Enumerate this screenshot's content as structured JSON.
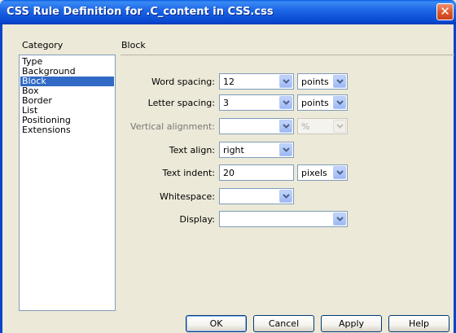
{
  "window": {
    "title": "CSS Rule Definition for .C_content in CSS.css"
  },
  "category": {
    "header": "Category",
    "items": [
      "Type",
      "Background",
      "Block",
      "Box",
      "Border",
      "List",
      "Positioning",
      "Extensions"
    ],
    "selected": "Block"
  },
  "panel": {
    "title": "Block",
    "word_spacing": {
      "label": "Word spacing:",
      "value": "12",
      "unit": "points"
    },
    "letter_spacing": {
      "label": "Letter spacing:",
      "value": "3",
      "unit": "points"
    },
    "vertical_alignment": {
      "label": "Vertical alignment:",
      "value": "",
      "unit": "%"
    },
    "text_align": {
      "label": "Text align:",
      "value": "right"
    },
    "text_indent": {
      "label": "Text indent:",
      "value": "20",
      "unit": "pixels"
    },
    "whitespace": {
      "label": "Whitespace:",
      "value": ""
    },
    "display": {
      "label": "Display:",
      "value": ""
    }
  },
  "buttons": {
    "ok": "OK",
    "cancel": "Cancel",
    "apply": "Apply",
    "help": "Help"
  },
  "colors": {
    "titlebar": "#0A5FE0",
    "dialog_bg": "#ECE9D8",
    "selection": "#316AC5",
    "field_border": "#7F9DB9"
  }
}
